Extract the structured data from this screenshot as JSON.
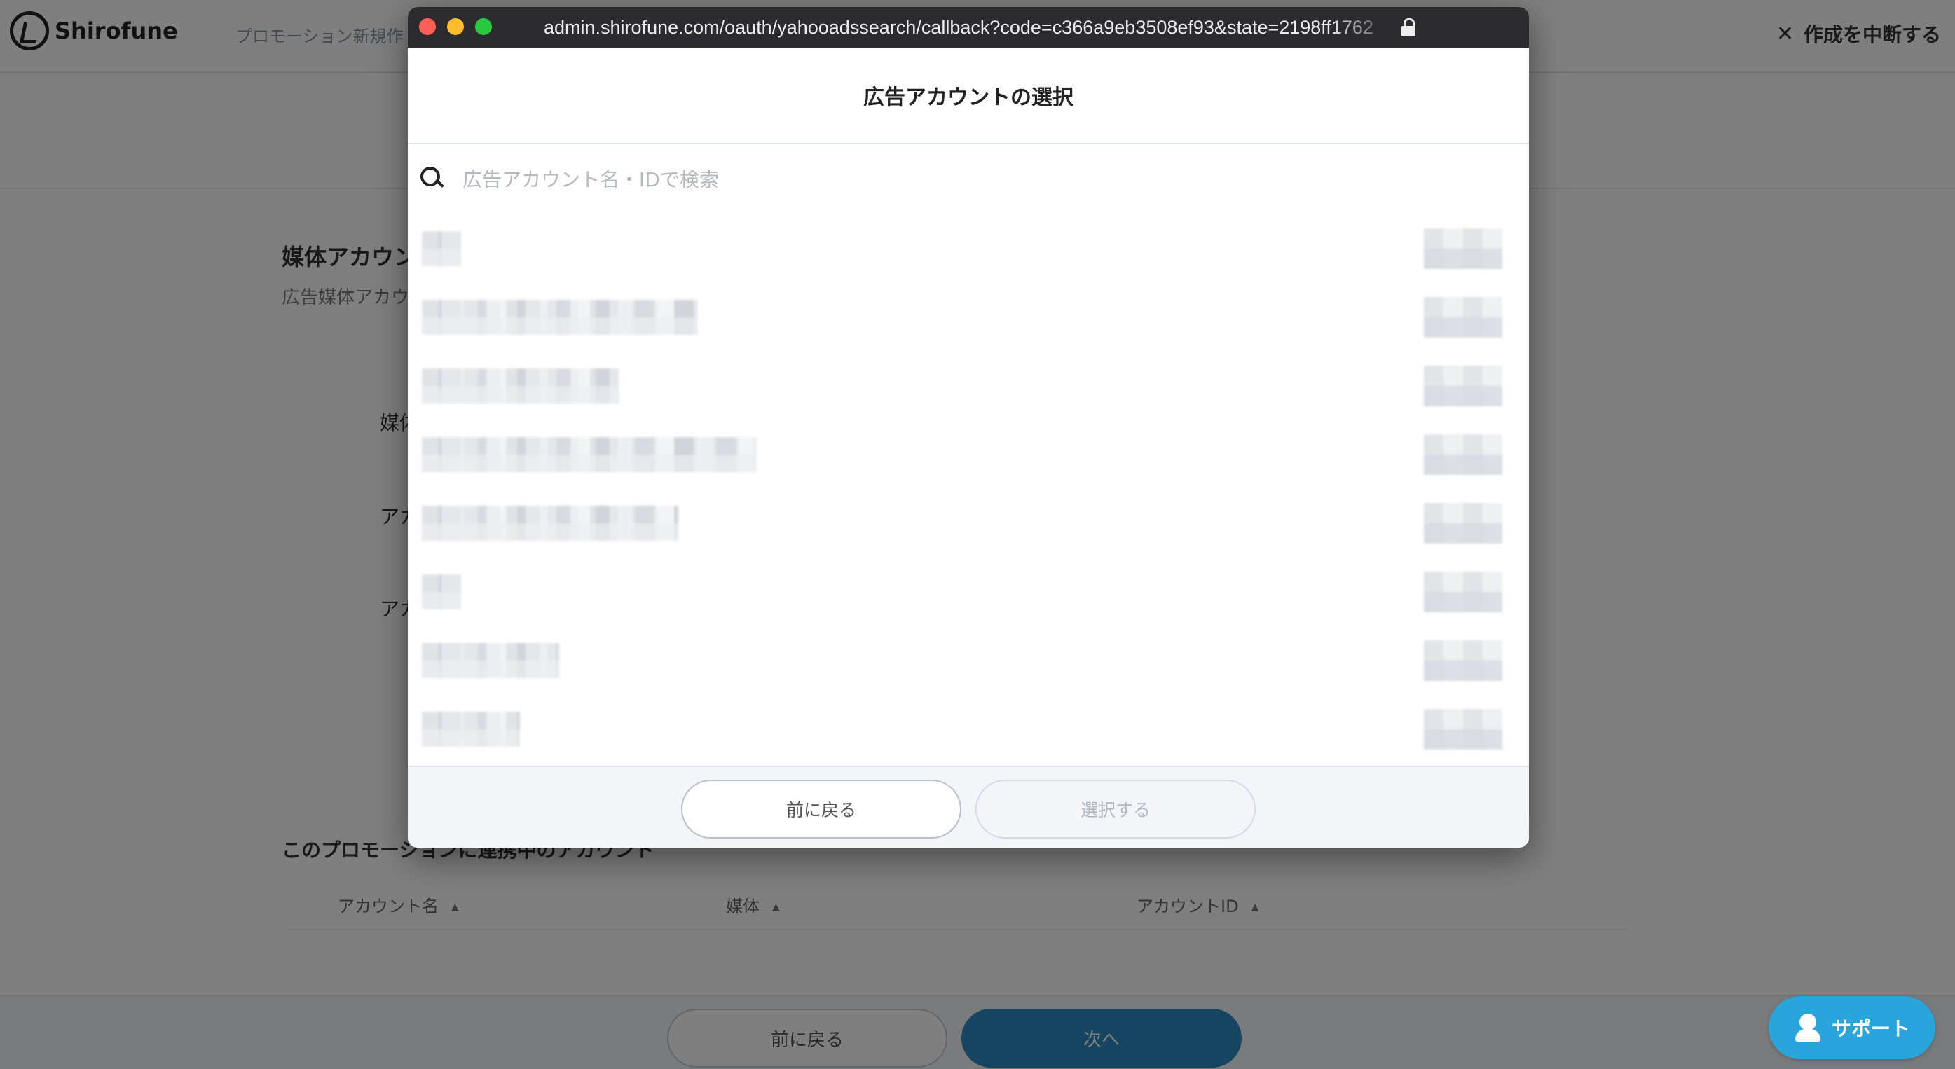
{
  "app": {
    "logo_text": "Shirofune",
    "header_crumb": "プロモーション新規作",
    "abort_label": "作成を中断する",
    "section_title": "媒体アカウン",
    "section_desc": "広告媒体アカウ",
    "field_labels": [
      "媒体",
      "アカ",
      "アカ"
    ],
    "linked_title": "このプロモーションに連携中のアカウント",
    "table_headers": [
      "アカウント名",
      "媒体",
      "アカウントID"
    ],
    "back_label": "前に戻る",
    "next_label": "次へ",
    "support_label": "サポート"
  },
  "popup": {
    "url": "admin.shirofune.com/oauth/yahooadssearch/callback?code=c366a9eb3508ef93&state=2198ff1762",
    "title": "広告アカウントの選択",
    "search_placeholder": "広告アカウント名・IDで検索",
    "back_label": "前に戻る",
    "select_label": "選択する",
    "accounts": [
      "redacted",
      "redacted",
      "redacted",
      "redacted",
      "redacted",
      "redacted",
      "redacted",
      "redacted"
    ]
  },
  "colors": {
    "primary": "#2a8bc2",
    "support": "#2aa5dc",
    "titlebar": "#2c2c2e"
  }
}
